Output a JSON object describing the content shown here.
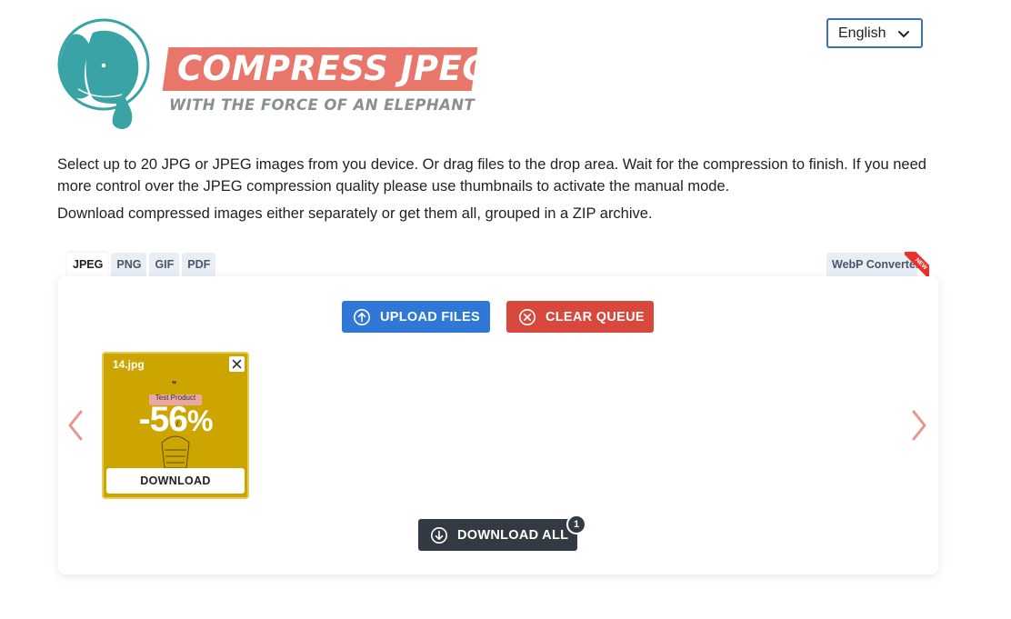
{
  "brand": {
    "title": "COMPRESS JPEG",
    "tagline": "WITH THE FORCE OF AN ELEPHANT",
    "colors": {
      "banner": "#e8766a",
      "elephant": "#3aa3a6",
      "tagline": "#8a8f94"
    }
  },
  "language": {
    "selected": "English"
  },
  "description": {
    "line1": "Select up to 20 JPG or JPEG images from you device. Or drag files to the drop area. Wait for the compression to finish. If you need more control over the JPEG compression quality please use thumbnails to activate the manual mode.",
    "line2": "Download compressed images either separately or get them all, grouped in a ZIP archive."
  },
  "tabs": [
    {
      "label": "JPEG",
      "active": true
    },
    {
      "label": "PNG",
      "active": false
    },
    {
      "label": "GIF",
      "active": false
    },
    {
      "label": "PDF",
      "active": false
    }
  ],
  "webp_tab": {
    "label": "WebP Converter",
    "ribbon": "NEW"
  },
  "toolbar": {
    "upload_label": "UPLOAD FILES",
    "clear_label": "CLEAR QUEUE"
  },
  "queue": {
    "items": [
      {
        "filename": "14.jpg",
        "ratio": "-56",
        "ratio_unit": "%",
        "download_label": "DOWNLOAD",
        "preview_text": "Test Product"
      }
    ]
  },
  "download_all": {
    "label": "DOWNLOAD ALL",
    "count": "1"
  },
  "colors": {
    "upload": "#2f78d8",
    "clear": "#d9483c",
    "download_all": "#343a44",
    "arrows": "#e9958c",
    "card": "#cda500"
  }
}
